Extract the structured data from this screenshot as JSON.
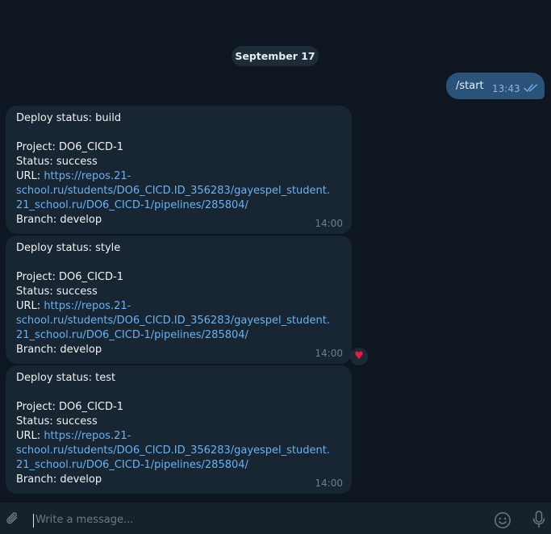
{
  "date_chip": "September 17",
  "outgoing": {
    "text": "/start",
    "time": "13:43"
  },
  "messages": [
    {
      "title": "Deploy status: build",
      "project": "Project: DO6_CICD-1",
      "status": "Status: success",
      "url_label": "URL: ",
      "url_lines": [
        "https://repos.21-",
        "school.ru/students/DO6_CICD.ID_356283/gayespel_student.",
        "21_school.ru/DO6_CICD-1/pipelines/285804/"
      ],
      "branch": "Branch: develop",
      "time": "14:00"
    },
    {
      "title": "Deploy status: style",
      "project": "Project: DO6_CICD-1",
      "status": "Status: success",
      "url_label": "URL: ",
      "url_lines": [
        "https://repos.21-",
        "school.ru/students/DO6_CICD.ID_356283/gayespel_student.",
        "21_school.ru/DO6_CICD-1/pipelines/285804/"
      ],
      "branch": "Branch: develop",
      "time": "14:00",
      "reaction": "♥"
    },
    {
      "title": "Deploy status: test",
      "project": "Project: DO6_CICD-1",
      "status": "Status: success",
      "url_label": "URL: ",
      "url_lines": [
        "https://repos.21-",
        "school.ru/students/DO6_CICD.ID_356283/gayespel_student.",
        "21_school.ru/DO6_CICD-1/pipelines/285804/"
      ],
      "branch": "Branch: develop",
      "time": "14:00"
    }
  ],
  "composer": {
    "placeholder": "Write a message..."
  },
  "icons": {
    "attach": "paperclip-icon",
    "emoji": "smile-icon",
    "mic": "microphone-icon",
    "read": "double-check-icon"
  },
  "colors": {
    "background": "#0e1621",
    "incoming_bubble": "#182533",
    "outgoing_bubble": "#2b5278",
    "link": "#6ab2f2",
    "composer": "#17212b"
  }
}
